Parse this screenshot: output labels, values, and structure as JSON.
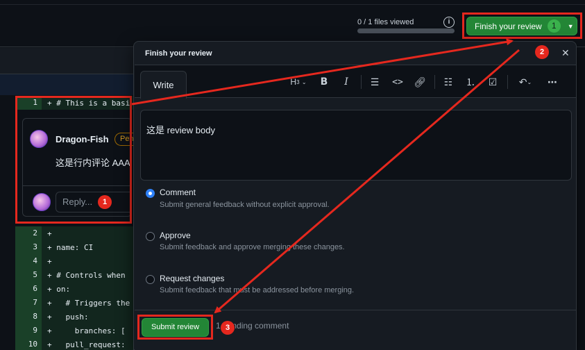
{
  "header": {
    "files_viewed": "0 / 1 files viewed",
    "finish_button_label": "Finish your review",
    "finish_button_count": "1"
  },
  "code": {
    "rows_top": [
      {
        "num": "1",
        "text": "+ # This is a basi"
      }
    ],
    "rows_bottom": [
      {
        "num": "2",
        "text": "+"
      },
      {
        "num": "3",
        "text": "+ name: CI"
      },
      {
        "num": "4",
        "text": "+"
      },
      {
        "num": "5",
        "text": "+ # Controls when"
      },
      {
        "num": "6",
        "text": "+ on:"
      },
      {
        "num": "7",
        "text": "+   # Triggers the"
      },
      {
        "num": "8",
        "text": "+   push:"
      },
      {
        "num": "9",
        "text": "+     branches: ["
      },
      {
        "num": "10",
        "text": "+   pull_request:"
      }
    ]
  },
  "comment": {
    "author": "Dragon-Fish",
    "badge": "Pen",
    "body": "这是行内评论 AAA",
    "reply_placeholder": "Reply..."
  },
  "modal": {
    "title": "Finish your review",
    "close": "✕",
    "tab_write": "Write",
    "body_text": "这是 review body",
    "options": [
      {
        "label": "Comment",
        "desc": "Submit general feedback without explicit approval.",
        "selected": true
      },
      {
        "label": "Approve",
        "desc": "Submit feedback and approve merging these changes.",
        "selected": false
      },
      {
        "label": "Request changes",
        "desc": "Submit feedback that must be addressed before merging.",
        "selected": false
      }
    ],
    "submit_label": "Submit review",
    "pending_text": "1 pending comment"
  },
  "markers": [
    "1",
    "2",
    "3"
  ],
  "colors": {
    "accent_green": "#238636",
    "annotation_red": "#e5281e",
    "radio_blue": "#2f81f7"
  }
}
